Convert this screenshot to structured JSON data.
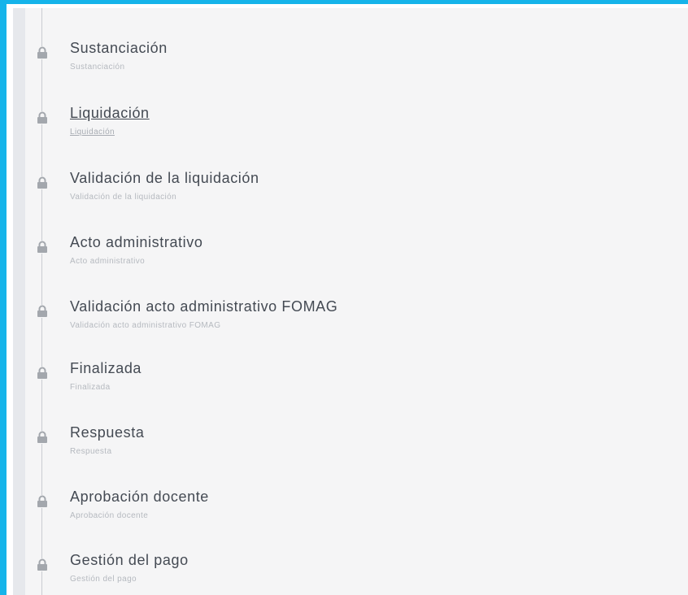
{
  "timeline": {
    "accent_color": "#15b4ea",
    "steps": [
      {
        "title": "Sustanciación",
        "subtitle": "Sustanciación",
        "icon": "lock-icon"
      },
      {
        "title": "Liquidación",
        "subtitle": "Liquidación",
        "icon": "lock-icon"
      },
      {
        "title": "Validación de la liquidación",
        "subtitle": "Validación de la liquidación",
        "icon": "lock-icon"
      },
      {
        "title": "Acto administrativo",
        "subtitle": "Acto administrativo",
        "icon": "lock-icon"
      },
      {
        "title": "Validación acto administrativo FOMAG",
        "subtitle": "Validación acto administrativo FOMAG",
        "icon": "lock-icon"
      },
      {
        "title": "Finalizada",
        "subtitle": "Finalizada",
        "icon": "lock-icon"
      },
      {
        "title": "Respuesta",
        "subtitle": "Respuesta",
        "icon": "lock-icon"
      },
      {
        "title": "Aprobación docente",
        "subtitle": "Aprobación docente",
        "icon": "lock-icon"
      },
      {
        "title": "Gestión del pago",
        "subtitle": "Gestión del pago",
        "icon": "lock-icon"
      }
    ]
  }
}
